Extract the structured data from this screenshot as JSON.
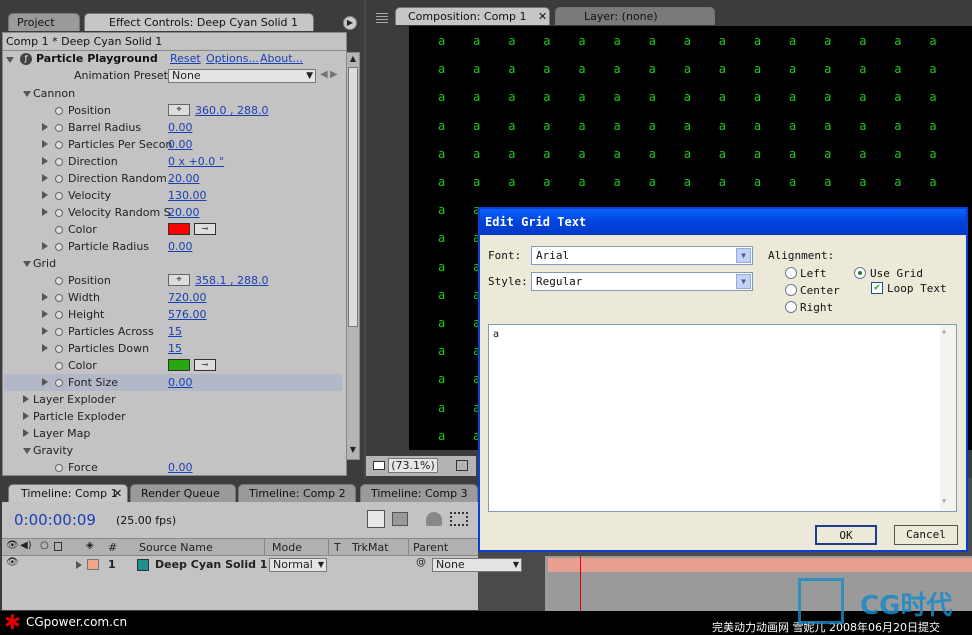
{
  "project_panel": {
    "tab_project": "Project",
    "tab_effect_controls": "Effect Controls: Deep Cyan Solid 1",
    "breadcrumb": "Comp 1 * Deep Cyan Solid 1",
    "effect_name": "Particle Playground",
    "reset": "Reset",
    "options": "Options...",
    "about": "About...",
    "animation_presets_label": "Animation Presets:",
    "animation_presets_value": "None"
  },
  "properties": [
    {
      "label": "Cannon",
      "type": "group",
      "expanded": true
    },
    {
      "label": "Position",
      "value": "360.0 , 288.0",
      "kind": "point"
    },
    {
      "label": "Barrel Radius",
      "value": "0.00"
    },
    {
      "label": "Particles Per Secon",
      "value": "0.00"
    },
    {
      "label": "Direction",
      "value": "0 x +0.0 °"
    },
    {
      "label": "Direction Random",
      "value": "20.00"
    },
    {
      "label": "Velocity",
      "value": "130.00"
    },
    {
      "label": "Velocity Random S",
      "value": "20.00"
    },
    {
      "label": "Color",
      "kind": "color",
      "color": "#ff0000"
    },
    {
      "label": "Particle Radius",
      "value": "0.00"
    },
    {
      "label": "Grid",
      "type": "group",
      "expanded": true
    },
    {
      "label": "Position",
      "value": "358.1 , 288.0",
      "kind": "point"
    },
    {
      "label": "Width",
      "value": "720.00"
    },
    {
      "label": "Height",
      "value": "576.00"
    },
    {
      "label": "Particles Across",
      "value": "15"
    },
    {
      "label": "Particles Down",
      "value": "15"
    },
    {
      "label": "Color",
      "kind": "color",
      "color": "#27a80f"
    },
    {
      "label": "Font Size",
      "value": "0.00",
      "selected": true
    },
    {
      "label": "Layer Exploder",
      "type": "group",
      "expanded": false
    },
    {
      "label": "Particle Exploder",
      "type": "group",
      "expanded": false
    },
    {
      "label": "Layer Map",
      "type": "group",
      "expanded": false
    },
    {
      "label": "Gravity",
      "type": "group",
      "expanded": true
    },
    {
      "label": "Force",
      "value": "0.00"
    }
  ],
  "composition": {
    "tab_comp": "Composition: Comp 1",
    "tab_layer": "Layer: (none)",
    "grid_char": "a",
    "zoom": "(73.1%)",
    "grid_color": "#23c423"
  },
  "dialog": {
    "title": "Edit Grid Text",
    "font_label": "Font:",
    "font_value": "Arial",
    "style_label": "Style:",
    "style_value": "Regular",
    "alignment_label": "Alignment:",
    "left": "Left",
    "center": "Center",
    "right": "Right",
    "use_grid": "Use Grid",
    "loop_text": "Loop Text",
    "text": "a",
    "ok": "OK",
    "cancel": "Cancel"
  },
  "timeline": {
    "tab_comp1": "Timeline: Comp 1",
    "tab_render": "Render Queue",
    "tab_comp2": "Timeline: Comp 2",
    "tab_comp3": "Timeline: Comp 3",
    "timecode": "0:00:00:09",
    "fps": "(25.00 fps)",
    "col_hash": "#",
    "col_source": "Source Name",
    "col_mode": "Mode",
    "col_t": "T",
    "col_trkmat": "TrkMat",
    "col_parent": "Parent",
    "layer_num": "1",
    "layer_name": "Deep Cyan Solid 1",
    "layer_mode": "Normal",
    "layer_parent": "None"
  },
  "footer": {
    "site": "CGpower.com.cn",
    "caption": "完美动力动画网 雪妮儿 2008年06月20日提交",
    "logo": "CG时代"
  }
}
